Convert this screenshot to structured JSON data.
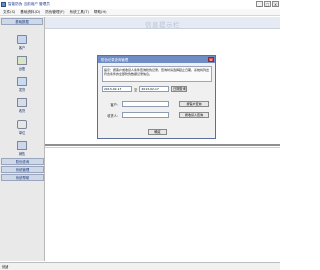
{
  "window": {
    "title": "智能防伪  当前用户  管理员",
    "controls": {
      "minimize": "_",
      "maximize": "□",
      "close": "x"
    }
  },
  "menu": {
    "items": [
      {
        "label": "文件(S)"
      },
      {
        "label": "基础资料(D)"
      },
      {
        "label": "防伪管理(F)"
      },
      {
        "label": "系统工具(T)"
      },
      {
        "label": "帮助(H)"
      }
    ]
  },
  "header": {
    "title": "信息提示栏"
  },
  "sidebar": {
    "header": "基础数据",
    "icons": [
      {
        "label": "客户"
      },
      {
        "label": "台账"
      },
      {
        "label": "发货"
      },
      {
        "label": "收货"
      },
      {
        "label": "单位"
      },
      {
        "label": "销售"
      }
    ],
    "buttons": [
      {
        "label": "防伪查询"
      },
      {
        "label": "系统管理"
      },
      {
        "label": "系统帮助"
      }
    ]
  },
  "dialog": {
    "title": "防伪记录查询管理",
    "close": "x",
    "notice": "提示：按客户或收货人条件查询防伪记录，查询时请选择起止日期，系统将列出符合条件的全部防伪数据记录信息。",
    "date_from": "2013-02-17",
    "date_separator": "至",
    "date_to": "2013-02-17",
    "query_button": "日期查询",
    "customer_label": "客户：",
    "customer_value": "",
    "customer_button": "按客户查询",
    "receiver_label": "收货人：",
    "receiver_value": "",
    "receiver_button": "按收货人查询",
    "ok_button": "确定"
  },
  "status": {
    "text": "就绪"
  }
}
